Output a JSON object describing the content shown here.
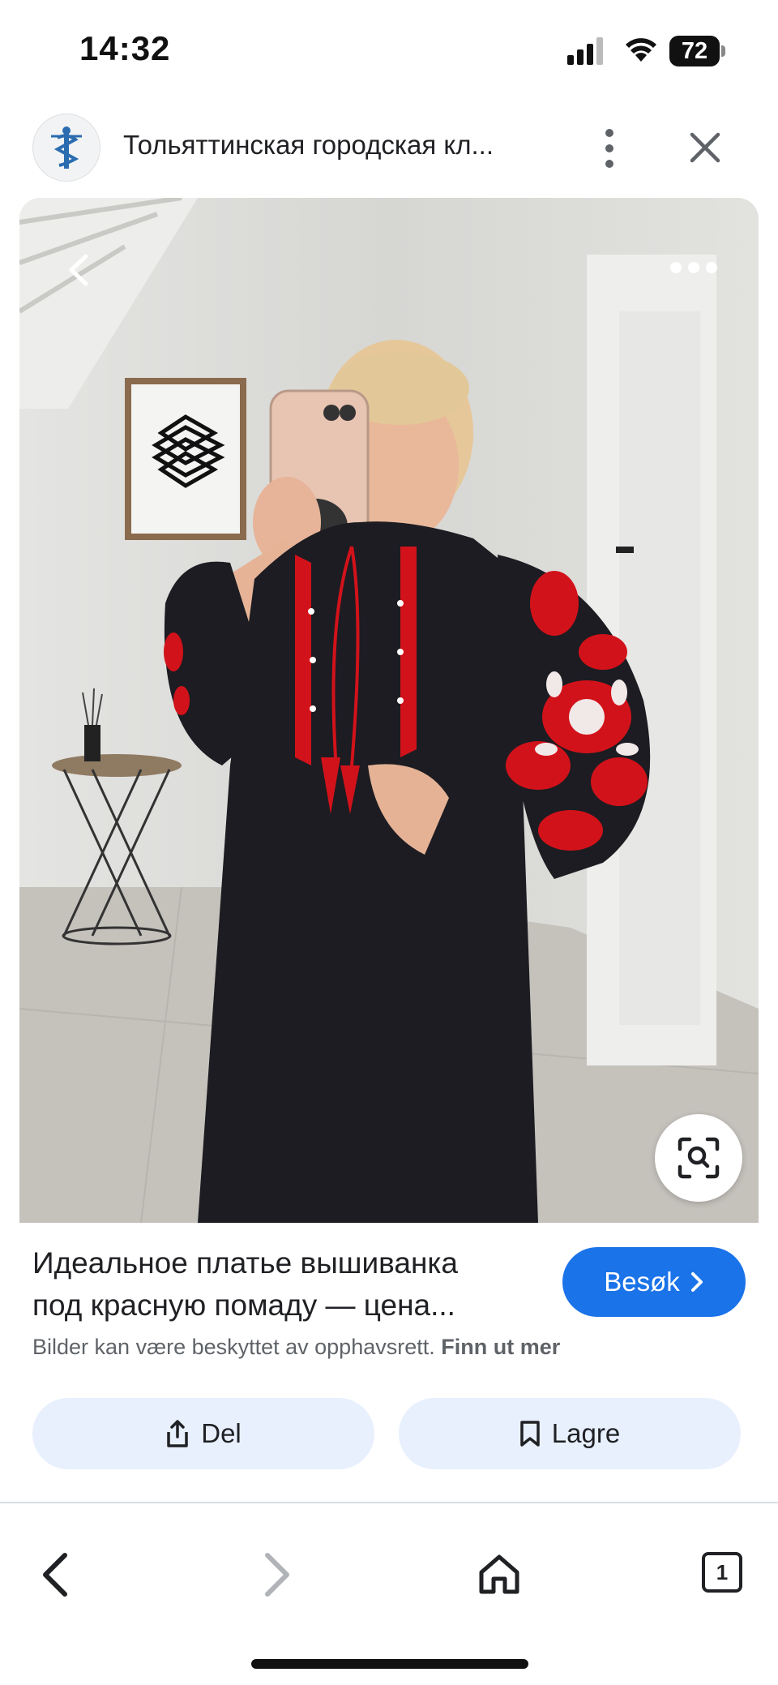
{
  "status_bar": {
    "time": "14:32",
    "battery": "72"
  },
  "header": {
    "site_title": "Тольяттинская городская кл...",
    "logo_icon": "caduceus-icon"
  },
  "image": {
    "description_icons": [
      "back-icon",
      "more-icon",
      "lens-search-icon"
    ]
  },
  "result": {
    "title_line1": "Идеальное платье вышиванка",
    "title_line2": "под красную помаду — цена...",
    "visit_label": "Besøk",
    "copyright_text": "Bilder kan være beskyttet av opphavsrett.",
    "learn_more": "Finn ut mer"
  },
  "actions": {
    "share_label": "Del",
    "save_label": "Lagre"
  },
  "toolbar": {
    "tabs_count": "1"
  },
  "colors": {
    "accent": "#1a73e8",
    "action_bg": "#e8f0fe",
    "dress": "#1c1c22",
    "embroidery": "#d2121a"
  }
}
